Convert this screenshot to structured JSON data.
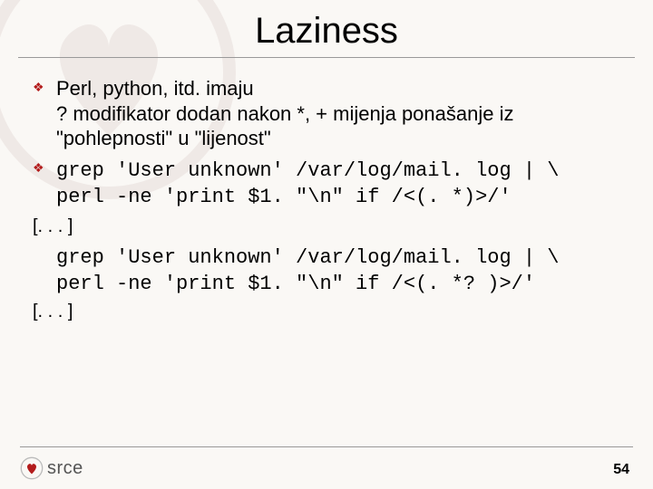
{
  "title": "Laziness",
  "bullets": [
    {
      "text": "Perl, python, itd. imaju\n? modifikator dodan nakon *, + mijenja ponašanje iz \"pohlepnosti\" u \"lijenost\"",
      "is_code": false
    },
    {
      "text": "grep 'User unknown' /var/log/mail. log | \\\nperl -ne 'print $1. \"\\n\" if /<(. *)>/'",
      "is_code": true
    }
  ],
  "omission": "[. . . ]",
  "free_code": "grep 'User unknown' /var/log/mail. log | \\\nperl -ne 'print $1. \"\\n\" if /<(. *? )>/'",
  "omission2": "[. . . ]",
  "footer": {
    "logo_text": "srce",
    "page": "54"
  },
  "icons": {
    "bullet": "❖"
  }
}
